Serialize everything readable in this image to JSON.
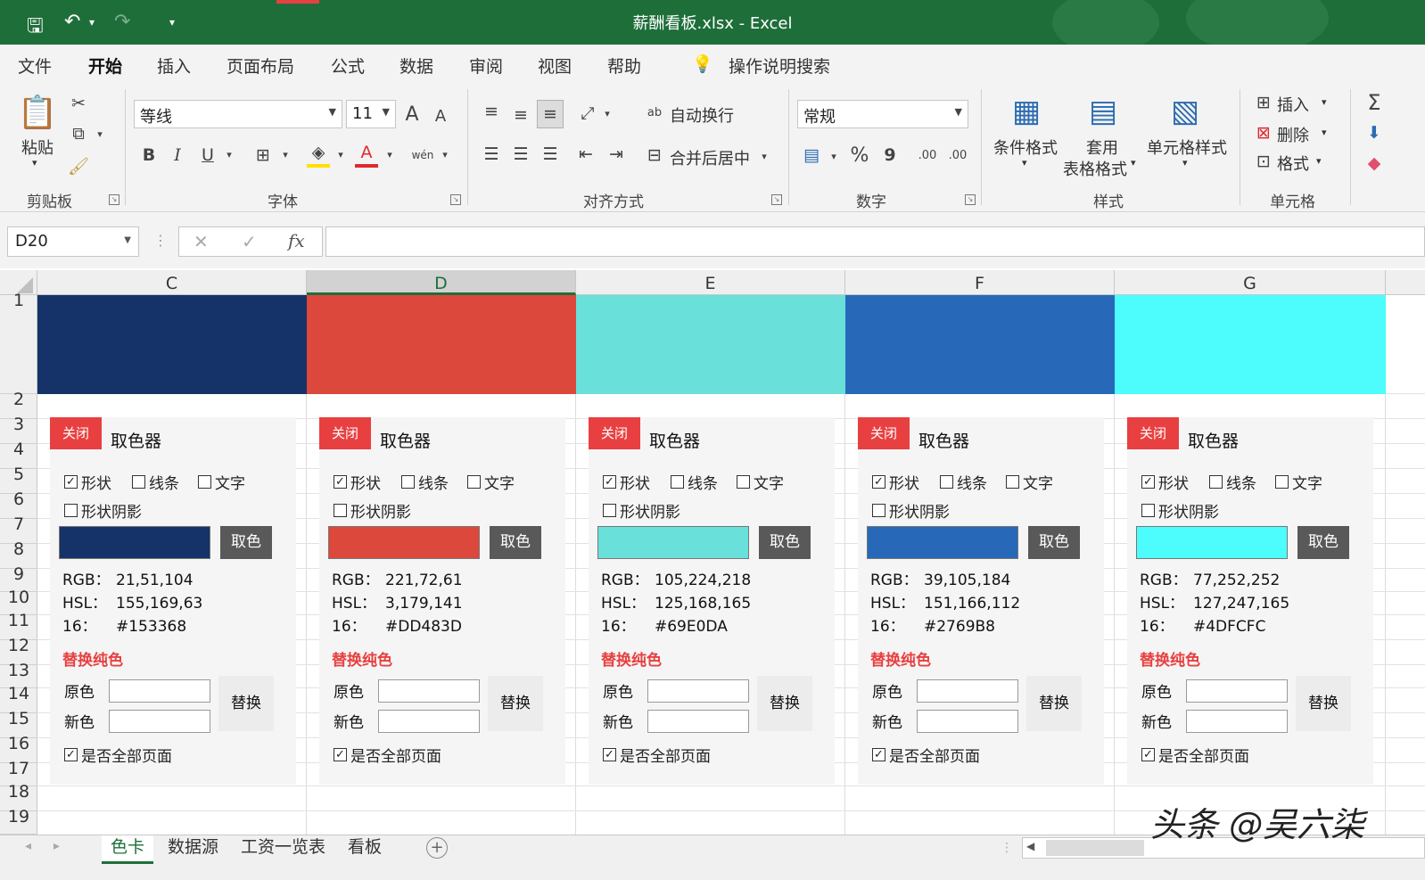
{
  "window": {
    "title": "薪酬看板.xlsx  -  Excel"
  },
  "menu": {
    "tabs": [
      "文件",
      "开始",
      "插入",
      "页面布局",
      "公式",
      "数据",
      "审阅",
      "视图",
      "帮助"
    ],
    "search": "操作说明搜索"
  },
  "ribbon": {
    "clipboard": {
      "paste": "粘贴",
      "label": "剪贴板"
    },
    "font": {
      "name": "等线",
      "size": "11",
      "grow": "A",
      "shrink": "A",
      "bold": "B",
      "italic": "I",
      "underline": "U",
      "phonetic": "wén",
      "label": "字体"
    },
    "align": {
      "wrap": "自动换行",
      "merge": "合并后居中",
      "label": "对齐方式"
    },
    "number": {
      "format": "常规",
      "percent": "%",
      "comma": "9",
      "inc": ".00",
      "dec": ".00",
      "label": "数字"
    },
    "styles": {
      "cond": "条件格式",
      "table1": "套用",
      "table2": "表格格式",
      "cell": "单元格样式",
      "label": "样式"
    },
    "cells": {
      "insert": "插入",
      "delete": "删除",
      "format": "格式",
      "label": "单元格"
    },
    "editing": {
      "sum": "Σ"
    }
  },
  "formula_bar": {
    "name_box": "D20",
    "fx": "fx",
    "value": ""
  },
  "grid": {
    "columns": [
      "C",
      "D",
      "E",
      "F",
      "G"
    ],
    "rows": [
      "1",
      "2",
      "3",
      "4",
      "5",
      "6",
      "7",
      "8",
      "9",
      "10",
      "11",
      "12",
      "13",
      "14",
      "15",
      "16",
      "17",
      "18",
      "19"
    ],
    "selected_column": "D"
  },
  "panels": [
    {
      "color": "#153368",
      "rgb": "21,51,104",
      "hsl": "155,169,63",
      "hex": "#153368"
    },
    {
      "color": "#DD483D",
      "rgb": "221,72,61",
      "hsl": "3,179,141",
      "hex": "#DD483D"
    },
    {
      "color": "#69E0DA",
      "rgb": "105,224,218",
      "hsl": "125,168,165",
      "hex": "#69E0DA"
    },
    {
      "color": "#2769B8",
      "rgb": "39,105,184",
      "hsl": "151,166,112",
      "hex": "#2769B8"
    },
    {
      "color": "#4DFCFC",
      "rgb": "77,252,252",
      "hsl": "127,247,165",
      "hex": "#4DFCFC"
    }
  ],
  "panel_text": {
    "close": "关闭",
    "title": "取色器",
    "shape": "形状",
    "line": "线条",
    "text": "文字",
    "shadow": "形状阴影",
    "pick": "取色",
    "rgb_k": "RGB：",
    "hsl_k": "HSL：",
    "hex_k": "16：",
    "replace": "替换纯色",
    "orig": "原色",
    "new": "新色",
    "replace_btn": "替换",
    "all_pages": "是否全部页面"
  },
  "sheets": [
    "色卡",
    "数据源",
    "工资一览表",
    "看板"
  ],
  "watermark": "头条 @吴六柒"
}
